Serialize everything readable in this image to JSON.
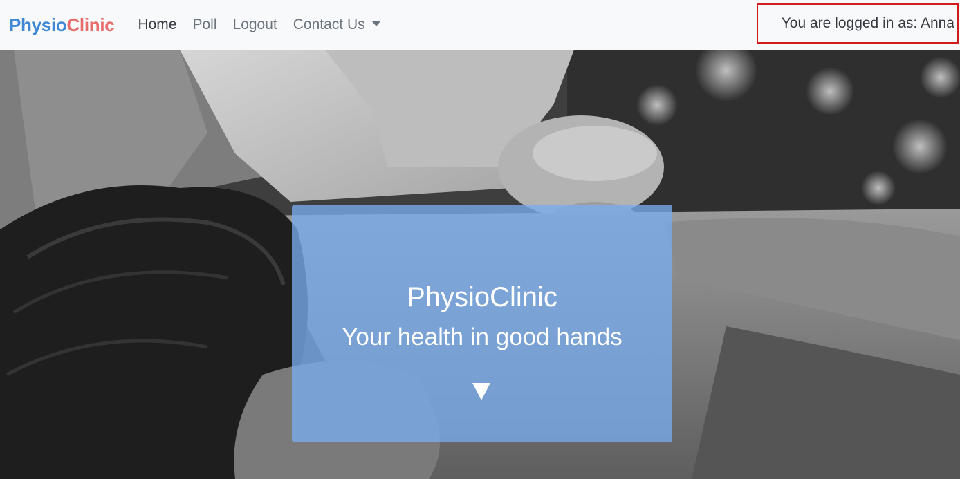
{
  "brand": {
    "part1": "Physio",
    "part2": "Clinic"
  },
  "nav": {
    "home": "Home",
    "poll": "Poll",
    "logout": "Logout",
    "contact": "Contact Us"
  },
  "user": {
    "logged_in_text": "You are logged in as: Anna"
  },
  "hero": {
    "title": "PhysioClinic",
    "subtitle": "Your health in good hands",
    "scroll_icon": "triangle-down-icon"
  },
  "colors": {
    "brand_blue": "#3f88d6",
    "brand_red": "#e86c6c",
    "highlight_border": "#d21b1b",
    "panel_blue": "#78acec"
  }
}
